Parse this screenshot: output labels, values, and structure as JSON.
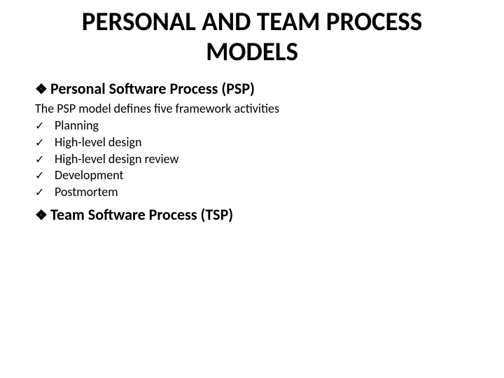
{
  "title": "PERSONAL AND TEAM PROCESS MODELS",
  "sections": [
    {
      "heading": "Personal Software Process (PSP)"
    }
  ],
  "intro": "The PSP model defines five framework activities",
  "activities": [
    "Planning",
    "High-level design",
    "High-level design review",
    "Development",
    "Postmortem"
  ],
  "section2": {
    "heading": "Team Software Process (TSP)"
  }
}
